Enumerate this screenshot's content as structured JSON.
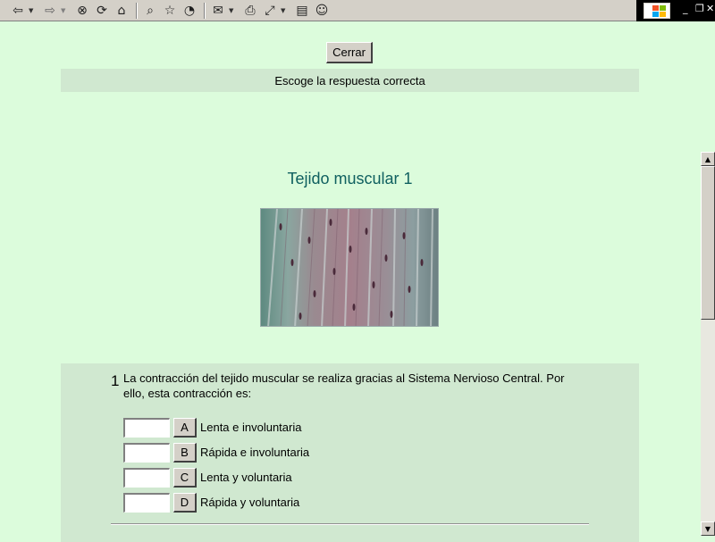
{
  "toolbar": {
    "icons": [
      "back-icon",
      "forward-icon",
      "stop-icon",
      "refresh-icon",
      "home-icon",
      "search-icon",
      "favorites-icon",
      "history-icon",
      "mail-icon",
      "print-icon",
      "fullscreen-icon",
      "edit-icon",
      "messenger-icon"
    ]
  },
  "page": {
    "close_label": "Cerrar",
    "instruction": "Escoge la respuesta correcta",
    "title": "Tejido muscular 1",
    "title_color": "#106060",
    "background": "#dcfcdc",
    "panel_color": "#d0e8d0"
  },
  "question": {
    "number": "1",
    "text": "La contracción del tejido muscular se realiza gracias al Sistema Nervioso Central. Por ello, esta contracción es:",
    "options": [
      {
        "letter": "A",
        "text": "Lenta e involuntaria",
        "value": ""
      },
      {
        "letter": "B",
        "text": "Rápida e involuntaria",
        "value": ""
      },
      {
        "letter": "C",
        "text": "Lenta y voluntaria",
        "value": ""
      },
      {
        "letter": "D",
        "text": "Rápida y voluntaria",
        "value": ""
      }
    ]
  }
}
